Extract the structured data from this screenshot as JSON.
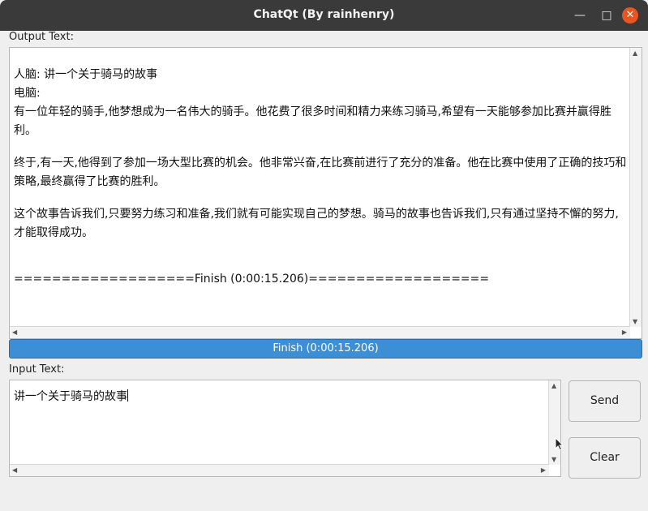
{
  "window": {
    "title": "ChatQt (By rainhenry)"
  },
  "output": {
    "label": "Output Text:",
    "lines": [
      "人脑: 讲一个关于骑马的故事",
      "电脑:",
      "有一位年轻的骑手,他梦想成为一名伟大的骑手。他花费了很多时间和精力来练习骑马,希望有一天能够参加比赛并赢得胜利。",
      "终于,有一天,他得到了参加一场大型比赛的机会。他非常兴奋,在比赛前进行了充分的准备。他在比赛中使用了正确的技巧和策略,最终赢得了比赛的胜利。",
      "这个故事告诉我们,只要努力练习和准备,我们就有可能实现自己的梦想。骑马的故事也告诉我们,只有通过坚持不懈的努力,才能取得成功。",
      "===================Finish (0:00:15.206)==================="
    ]
  },
  "progress": {
    "text": "Finish (0:00:15.206)",
    "percent": 100
  },
  "input": {
    "label": "Input Text:",
    "value": "讲一个关于骑马的故事"
  },
  "buttons": {
    "send": "Send",
    "clear": "Clear"
  }
}
